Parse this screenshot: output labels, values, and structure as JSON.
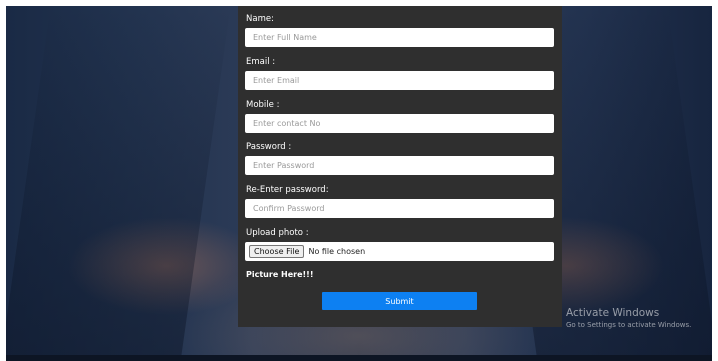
{
  "form": {
    "name_label": "Name:",
    "name_placeholder": "Enter Full Name",
    "email_label": "Email :",
    "email_placeholder": "Enter Email",
    "mobile_label": "Mobile :",
    "mobile_placeholder": "Enter contact No",
    "password_label": "Password :",
    "password_placeholder": "Enter Password",
    "reenter_label": "Re-Enter password:",
    "reenter_placeholder": "Confirm Password",
    "upload_label": "Upload photo :",
    "choose_file_label": "Choose File",
    "file_status": "No file chosen",
    "picture_text": "Picture Here!!!",
    "submit_label": "Submit"
  },
  "watermark": {
    "title": "Activate Windows",
    "subtitle": "Go to Settings to activate Windows."
  },
  "colors": {
    "panel_bg": "#2f2f2f",
    "submit_bg": "#0d80f2",
    "background": "#22334f"
  }
}
